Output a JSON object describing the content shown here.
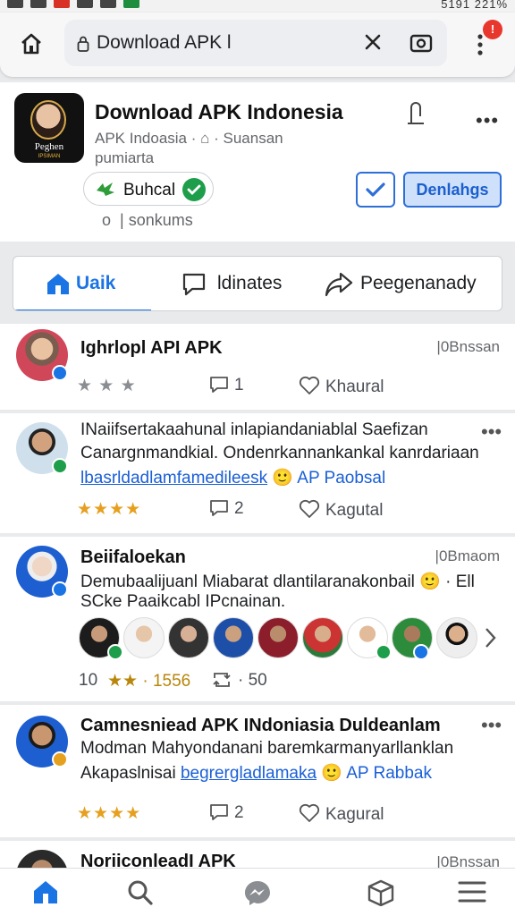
{
  "statusbar": {
    "right_text": "5191 221%"
  },
  "browser": {
    "url": "Download APK l",
    "notification_count": "!"
  },
  "page": {
    "title": "Download APK Indonesia",
    "subtitle_line1": "APK Indoasia · ⌂ · Suansan",
    "subtitle_line2": "pumiarta",
    "logo_text": "Peghen",
    "logo_subtext": "IPSIMAN",
    "chip_label": "Buhcal",
    "download_label": "Denlahgs",
    "meta_text": "| sonkums",
    "meta_prefix": "o"
  },
  "tabs": [
    {
      "label": "Uaik",
      "active": true
    },
    {
      "label": "ldinates",
      "active": false
    },
    {
      "label": "Peegenanady",
      "active": false
    }
  ],
  "posts": [
    {
      "title": "Ighrlopl API APK",
      "time": "|0Bnssan",
      "rating_text": "★ ★ ★",
      "comments": "1",
      "like_label": "Khaural"
    },
    {
      "line1": "INaiifsertakaahunal inlapiandaniablal Saefizan",
      "line2": "Canargnmandkial. Ondenrkannankankal kanrdariaan",
      "link": "lbasrldadlamfamedileesk",
      "tail": " 🙂 AP Paobsal",
      "rating_text": "★★★★",
      "comments": "2",
      "like_label": "Kagutal"
    },
    {
      "title": "Beiifaloekan",
      "time": "|0Bmaom",
      "line1": "Demubaalijuanl Miabarat dlantilaranakonbail 🙂 · Ell",
      "line2": "SCke Paaikcabl IPcnainan.",
      "stat_count": "10",
      "stat_rating": "★★ · 1556",
      "stat_shares": "· 50"
    },
    {
      "title": "Camnesniead APK INdoniasia Duldeanlam",
      "line1": "Modman Mahyondanani baremkarmanyarllanklan",
      "line2_pre": "Akapaslnisai ",
      "link": "begrergladlamaka",
      "tail": " 🙂 AP Rabbak",
      "rating_text": "★★★★",
      "comments": "2",
      "like_label": "Kagural"
    },
    {
      "title": "NoriiconleadI APK",
      "time": "|0Bnssan"
    }
  ],
  "colors": {
    "accent": "#1b74e4",
    "star": "#e6a020",
    "notification": "#e8372c",
    "verified": "#1e9e4a"
  },
  "icons": [
    "home-icon",
    "lock-icon",
    "close-icon",
    "camera-icon",
    "more-vertical-icon",
    "flag-icon",
    "check-icon",
    "house-tab-icon",
    "comment-tab-icon",
    "share-tab-icon",
    "comment-icon",
    "heart-icon",
    "search-icon",
    "messenger-icon",
    "marketplace-icon",
    "menu-icon"
  ]
}
